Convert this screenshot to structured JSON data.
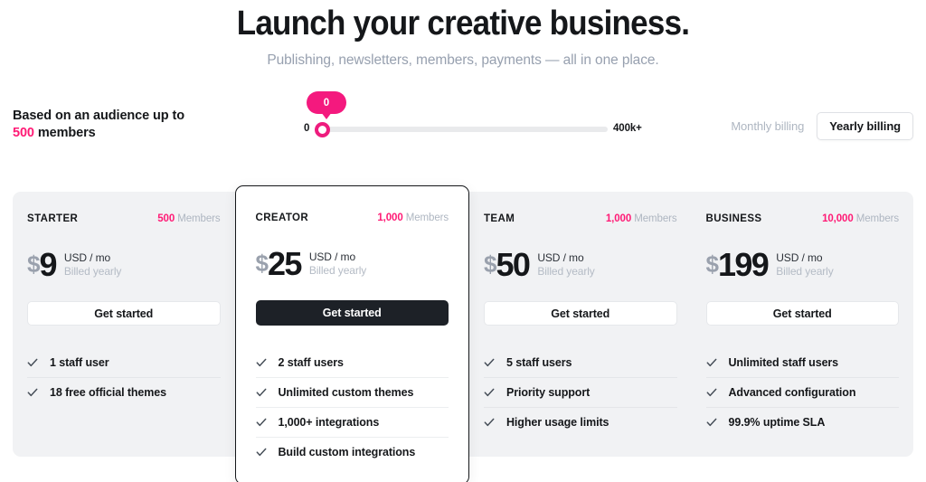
{
  "hero": {
    "title": "Launch your creative business.",
    "subtitle": "Publishing, newsletters, members, payments — all in one place."
  },
  "audience": {
    "prefix": "Based on an audience up to",
    "count": "500",
    "suffix": "members"
  },
  "slider": {
    "min_label": "0",
    "max_label": "400k+",
    "tooltip_value": "0",
    "value": 0,
    "accent_color": "#f4197e"
  },
  "billing": {
    "monthly_label": "Monthly billing",
    "yearly_label": "Yearly billing",
    "selected": "Yearly billing"
  },
  "plans": [
    {
      "name": "STARTER",
      "members_count": "500",
      "members_label": "Members",
      "currency": "$",
      "amount": "9",
      "unit": "USD / mo",
      "billed": "Billed yearly",
      "cta": "Get started",
      "featured": false,
      "features": [
        "1 staff user",
        "18 free official themes"
      ]
    },
    {
      "name": "CREATOR",
      "members_count": "1,000",
      "members_label": "Members",
      "currency": "$",
      "amount": "25",
      "unit": "USD / mo",
      "billed": "Billed yearly",
      "cta": "Get started",
      "featured": true,
      "features": [
        "2 staff users",
        "Unlimited custom themes",
        "1,000+ integrations",
        "Build custom integrations"
      ]
    },
    {
      "name": "TEAM",
      "members_count": "1,000",
      "members_label": "Members",
      "currency": "$",
      "amount": "50",
      "unit": "USD / mo",
      "billed": "Billed yearly",
      "cta": "Get started",
      "featured": false,
      "features": [
        "5 staff users",
        "Priority support",
        "Higher usage limits"
      ]
    },
    {
      "name": "BUSINESS",
      "members_count": "10,000",
      "members_label": "Members",
      "currency": "$",
      "amount": "199",
      "unit": "USD / mo",
      "billed": "Billed yearly",
      "cta": "Get started",
      "featured": false,
      "features": [
        "Unlimited staff users",
        "Advanced configuration",
        "99.9% uptime SLA"
      ]
    }
  ],
  "colors": {
    "brand_pink": "#ff1a75",
    "dark": "#15171a",
    "panel": "#f1f2f4"
  }
}
